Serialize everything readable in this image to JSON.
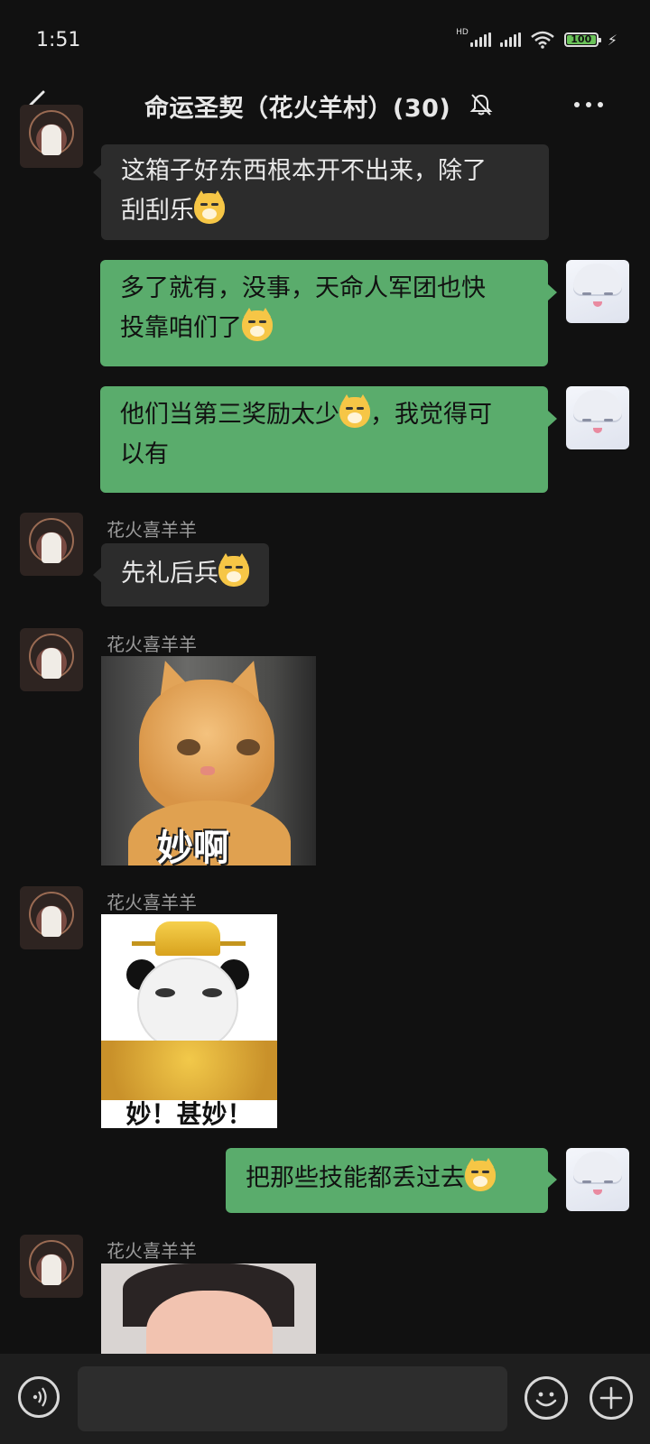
{
  "status_bar": {
    "time": "1:51",
    "network_label": "HD",
    "battery_level": "100"
  },
  "header": {
    "title": "命运圣契（花火羊村）(30)",
    "muted": true
  },
  "messages": [
    {
      "from": "other",
      "text_lines": [
        "这箱子好东西根本开不出来，除了",
        "刮刮乐"
      ],
      "emoji": "cat-emoji"
    },
    {
      "from": "self",
      "text_lines": [
        "多了就有，没事，天命人军团也快",
        "投靠咱们了"
      ],
      "emoji": "cat-emoji"
    },
    {
      "from": "self",
      "text_lines": [
        "他们当第三奖励太少",
        "，我觉得可",
        "以有"
      ],
      "emoji": "cat-emoji"
    },
    {
      "from": "other",
      "sender": "花火喜羊羊",
      "text": "先礼后兵",
      "emoji": "cat-emoji"
    },
    {
      "from": "other",
      "sender": "花火喜羊羊",
      "sticker_caption": "妙啊"
    },
    {
      "from": "other",
      "sender": "花火喜羊羊",
      "sticker_caption": "妙！甚妙！"
    },
    {
      "from": "self",
      "text": "把那些技能都丢过去",
      "emoji": "cat-emoji"
    },
    {
      "from": "other",
      "sender": "花火喜羊羊",
      "sticker_caption": ""
    }
  ],
  "input": {
    "value": "",
    "placeholder": ""
  },
  "colors": {
    "background": "#111111",
    "self_bubble": "#5aac6c",
    "other_bubble": "#2c2c2c",
    "battery_green": "#6ac259"
  }
}
